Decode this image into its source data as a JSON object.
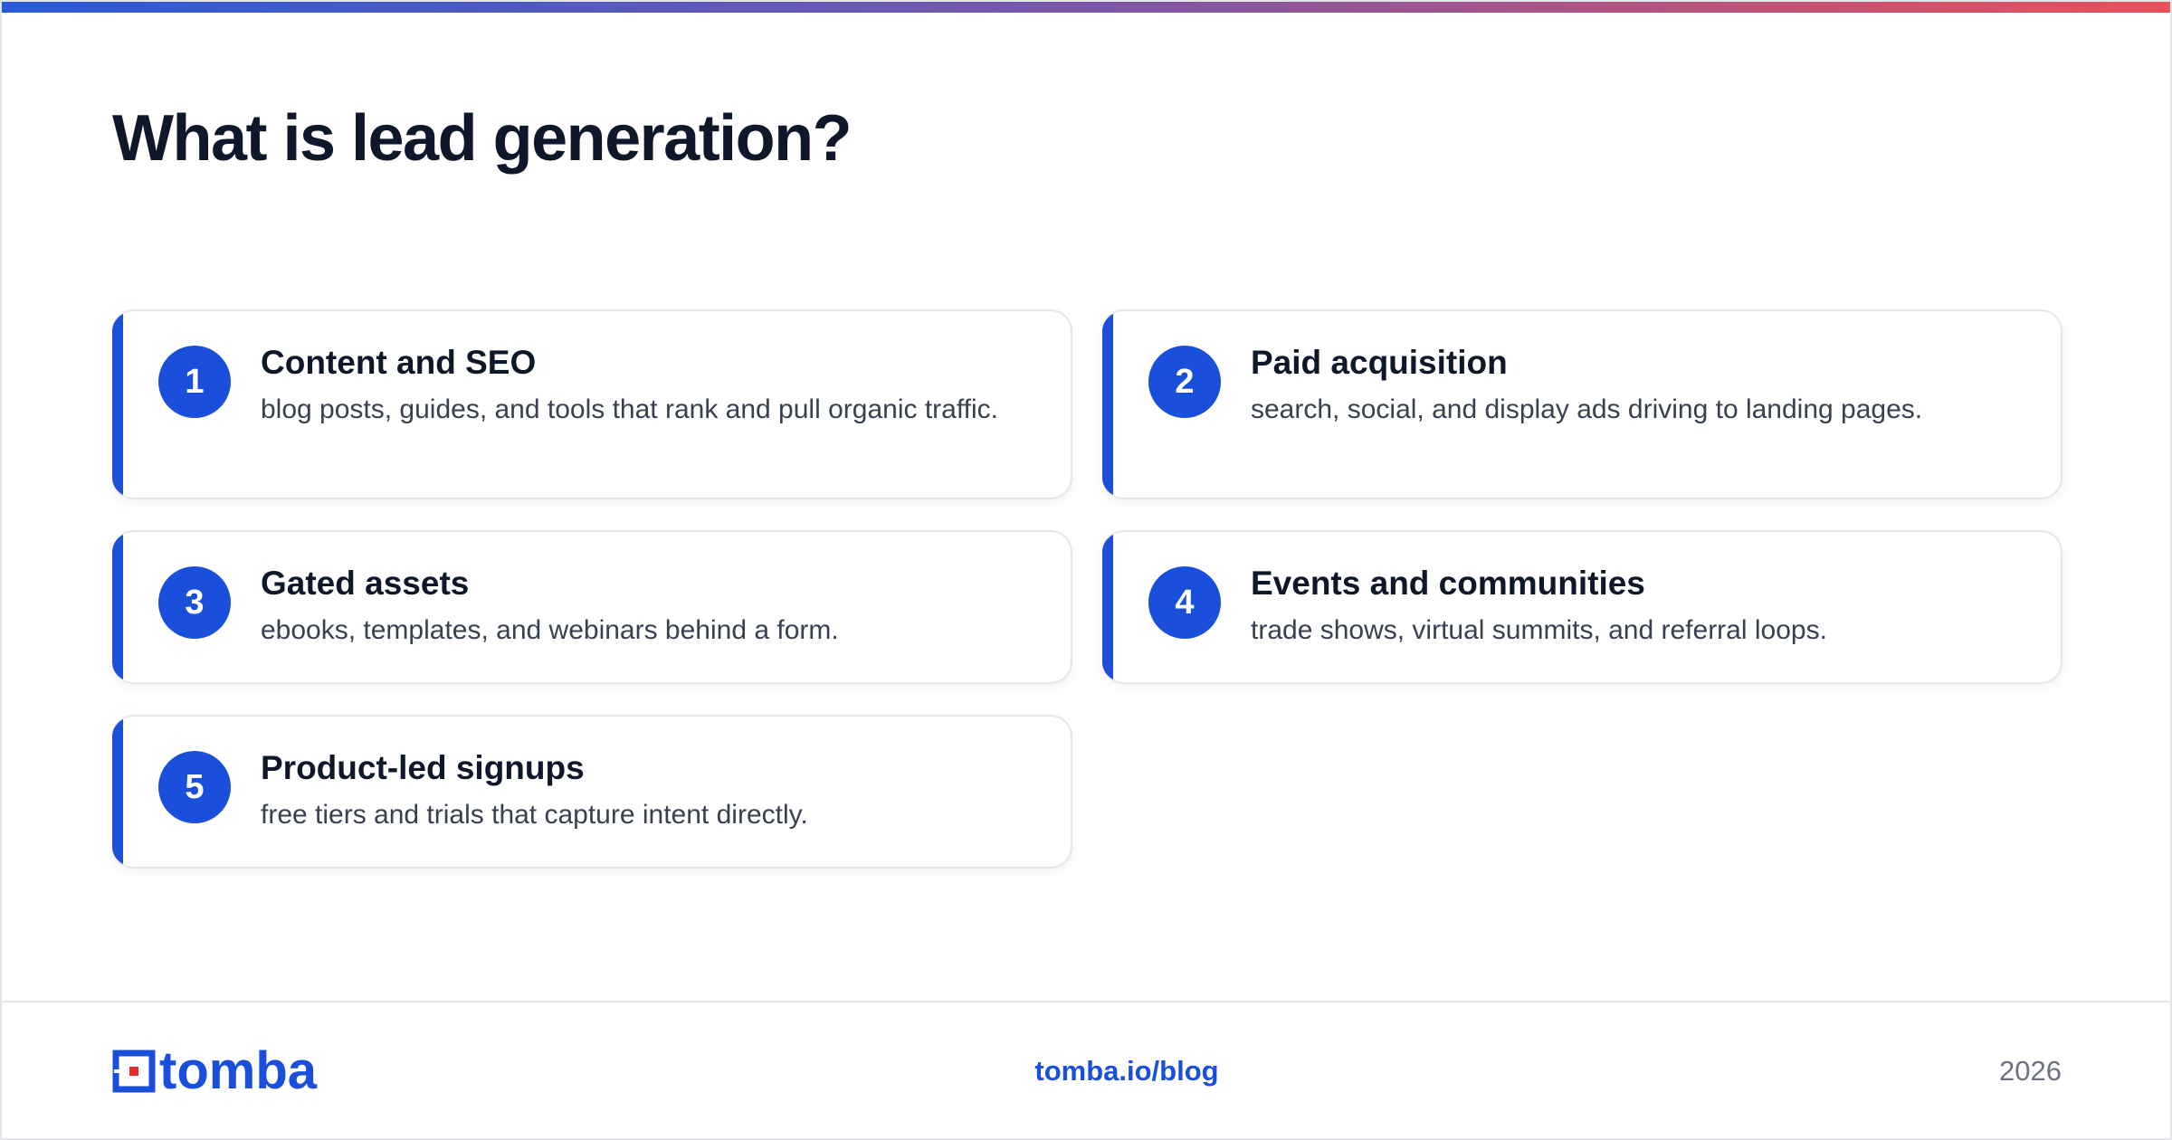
{
  "header": {
    "title": "What is lead generation?"
  },
  "cards": [
    {
      "number": "1",
      "title": "Content and SEO",
      "description": "blog posts, guides, and tools that rank and pull organic traffic."
    },
    {
      "number": "2",
      "title": "Paid acquisition",
      "description": "search, social, and display ads driving to landing pages."
    },
    {
      "number": "3",
      "title": "Gated assets",
      "description": "ebooks, templates, and webinars behind a form."
    },
    {
      "number": "4",
      "title": "Events and communities",
      "description": "trade shows, virtual summits, and referral loops."
    },
    {
      "number": "5",
      "title": "Product-led signups",
      "description": "free tiers and trials that capture intent directly."
    }
  ],
  "footer": {
    "logo_text": "tomba",
    "link": "tomba.io/blog",
    "year": "2026"
  },
  "colors": {
    "accent": "#1a4fdb",
    "logo_red": "#e32b2b",
    "title": "#0f172a",
    "gradient_start": "#2a5bd7",
    "gradient_end": "#e9505a"
  },
  "icons": {
    "logo": "tomba-logo-icon"
  }
}
